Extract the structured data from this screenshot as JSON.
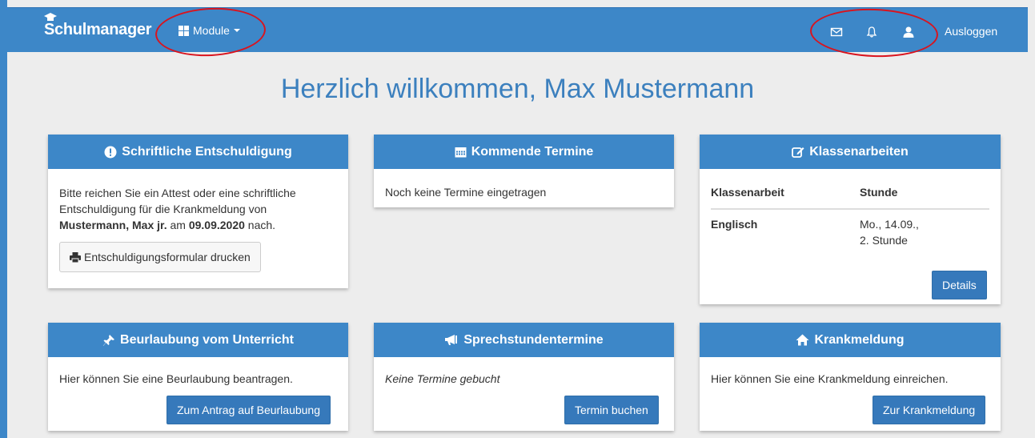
{
  "navbar": {
    "brand": "Schulmanager",
    "module_label": "Module",
    "mail_icon": "envelope-icon",
    "bell_icon": "bell-icon",
    "user_icon": "user-icon",
    "logout_label": "Ausloggen",
    "color": "#3d87c8"
  },
  "page": {
    "title": "Herzlich willkommen, Max Mustermann"
  },
  "cards": {
    "entschuldigung": {
      "title": "Schriftliche Entschuldigung",
      "icon": "exclamation-circle-icon",
      "text_1": "Bitte reichen Sie ein Attest oder eine schriftliche Entschuldigung für die Krankmeldung von",
      "name": "Mustermann, Max jr.",
      "text_2": "am",
      "date": "09.09.2020",
      "text_3": "nach.",
      "button": "Entschuldigungsformular drucken",
      "button_icon": "printer-icon"
    },
    "termine": {
      "title": "Kommende Termine",
      "icon": "calendar-icon",
      "text": "Noch keine Termine eingetragen"
    },
    "klassenarbeiten": {
      "title": "Klassenarbeiten",
      "icon": "edit-icon",
      "col_1": "Klassenarbeit",
      "col_2": "Stunde",
      "rows": [
        {
          "subject": "Englisch",
          "date": "Mo., 14.09.,",
          "lesson": "2. Stunde"
        }
      ],
      "button": "Details"
    },
    "beurlaubung": {
      "title": "Beurlaubung vom Unterricht",
      "icon": "pushpin-icon",
      "text": "Hier können Sie eine Beurlaubung beantragen.",
      "button": "Zum Antrag auf Beurlaubung"
    },
    "sprechstunden": {
      "title": "Sprechstundentermine",
      "icon": "megaphone-icon",
      "text": "Keine Termine gebucht",
      "button": "Termin buchen"
    },
    "krankmeldung": {
      "title": "Krankmeldung",
      "icon": "home-icon",
      "text": "Hier können Sie eine Krankmeldung einreichen.",
      "button": "Zur Krankmeldung"
    }
  }
}
